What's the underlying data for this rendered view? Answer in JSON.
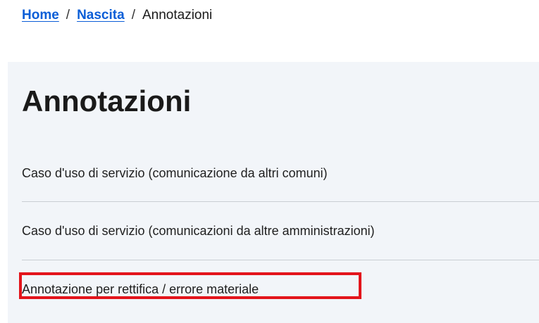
{
  "breadcrumb": {
    "items": [
      {
        "label": "Home",
        "link": true
      },
      {
        "label": "Nascita",
        "link": true
      },
      {
        "label": "Annotazioni",
        "link": false
      }
    ],
    "separator": "/"
  },
  "main": {
    "title": "Annotazioni",
    "items": [
      {
        "label": "Caso d'uso di servizio (comunicazione da altri comuni)"
      },
      {
        "label": "Caso d'uso di servizio (comunicazioni da altre amministrazioni)"
      },
      {
        "label": "Annotazione per rettifica / errore materiale",
        "highlighted": true
      }
    ]
  },
  "colors": {
    "link": "#0b5ed7",
    "panel_background": "#f2f5f9",
    "highlight_border": "#e3141b",
    "divider": "#c9ced4"
  }
}
